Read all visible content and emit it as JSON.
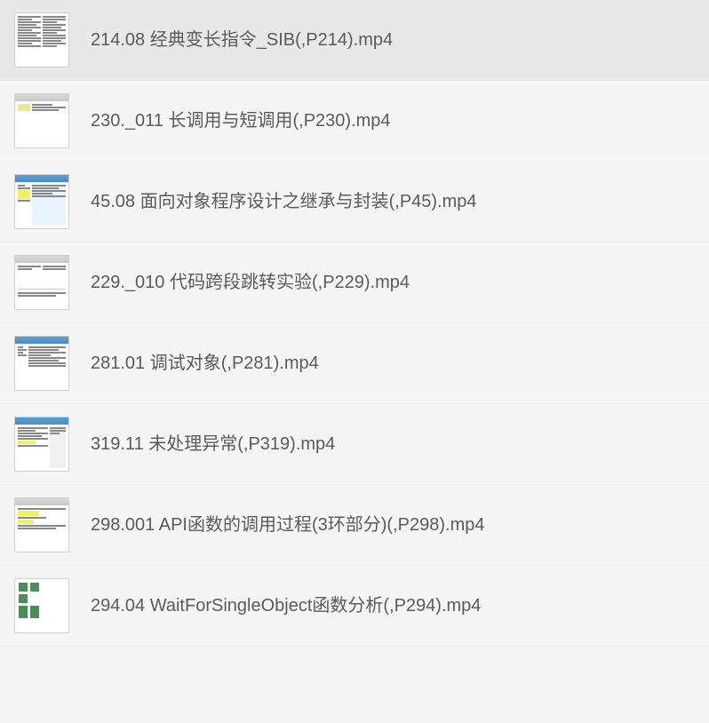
{
  "files": [
    {
      "name": "214.08 经典变长指令_SIB(,P214).mp4",
      "selected": true,
      "thumb_style": "text-dense"
    },
    {
      "name": "230._011 长调用与短调用(,P230).mp4",
      "selected": false,
      "thumb_style": "light-toolbar"
    },
    {
      "name": "45.08 面向对象程序设计之继承与封装(,P45).mp4",
      "selected": false,
      "thumb_style": "blue-header-yellow"
    },
    {
      "name": "229._010 代码跨段跳转实验(,P229).mp4",
      "selected": false,
      "thumb_style": "gray-split"
    },
    {
      "name": "281.01 调试对象(,P281).mp4",
      "selected": false,
      "thumb_style": "blue-header-code"
    },
    {
      "name": "319.11 未处理异常(,P319).mp4",
      "selected": false,
      "thumb_style": "blue-header-two-pane"
    },
    {
      "name": "298.001 API函数的调用过程(3环部分)(,P298).mp4",
      "selected": false,
      "thumb_style": "gray-yellow-blocks"
    },
    {
      "name": "294.04 WaitForSingleObject函数分析(,P294).mp4",
      "selected": false,
      "thumb_style": "green-blocks"
    }
  ]
}
